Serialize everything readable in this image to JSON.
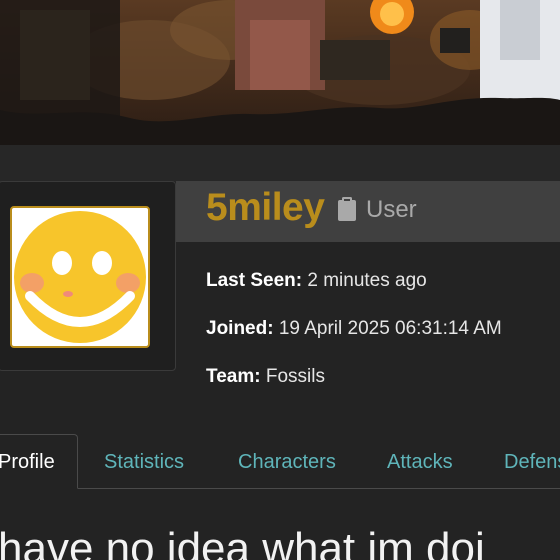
{
  "profile": {
    "username": "5miley",
    "role": "User",
    "last_seen_label": "Last Seen:",
    "last_seen_value": "2 minutes ago",
    "joined_label": "Joined:",
    "joined_value": "19 April 2025 06:31:14 AM",
    "team_label": "Team:",
    "team_value": "Fossils"
  },
  "tabs": [
    {
      "label": "Profile",
      "active": true
    },
    {
      "label": "Statistics",
      "active": false
    },
    {
      "label": "Characters",
      "active": false
    },
    {
      "label": "Attacks",
      "active": false
    },
    {
      "label": "Defens",
      "active": false
    }
  ],
  "bio": "have no idea what im doi",
  "colors": {
    "accent_gold": "#b98d1c",
    "tab_link": "#5fb5ba",
    "background": "#232323"
  },
  "icons": {
    "role": "clipboard-icon",
    "avatar": "smiley-face-icon"
  }
}
